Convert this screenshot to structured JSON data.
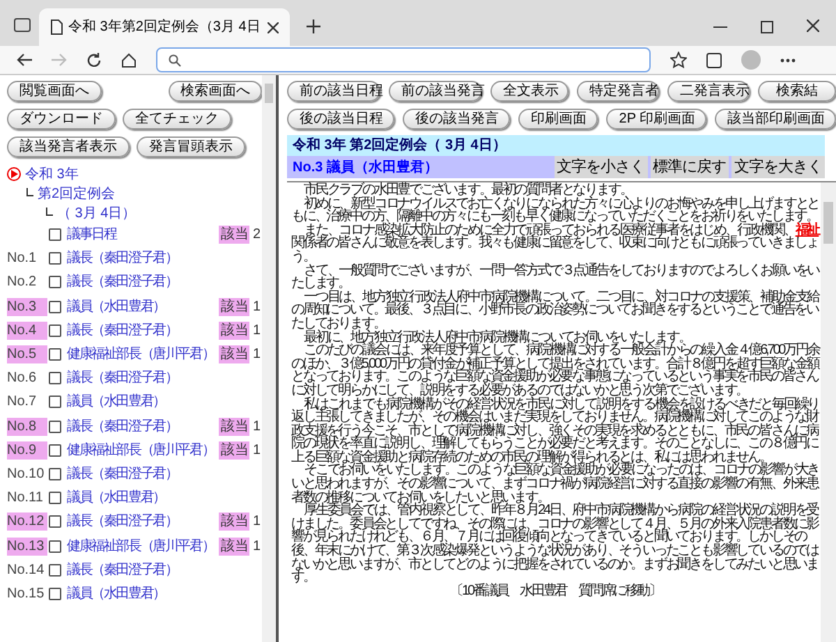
{
  "browser": {
    "tab_title": "令和 3年第2回定例会（3月 4日"
  },
  "left_buttons": [
    [
      "閲覧画面へ",
      "検索画面へ"
    ],
    [
      "ダウンロード",
      "全てチェック"
    ],
    [
      "該当発言者表示",
      "発言冒頭表示"
    ]
  ],
  "tree": {
    "label": "令和 3年",
    "children": [
      {
        "label": "第2回定例会",
        "children": [
          {
            "label": "（ 3月 4日）"
          }
        ]
      }
    ]
  },
  "speeches": [
    {
      "highlighted": false,
      "checked": false,
      "label": "議事日程",
      "badge": "該当",
      "count": "2"
    },
    {
      "no": "No.1",
      "highlighted": false,
      "checked": false,
      "label": "議長（秦田澄子君）"
    },
    {
      "no": "No.2",
      "highlighted": false,
      "checked": false,
      "label": "議長（秦田澄子君）"
    },
    {
      "no": "No.3",
      "highlighted": true,
      "checked": false,
      "label": "議員（水田豊君）",
      "badge": "該当",
      "count": "1"
    },
    {
      "no": "No.4",
      "highlighted": true,
      "checked": false,
      "label": "議長（秦田澄子君）",
      "badge": "該当",
      "count": "1"
    },
    {
      "no": "No.5",
      "highlighted": true,
      "checked": false,
      "label": "健康福祉部長（唐川平君）",
      "badge": "該当",
      "count": "1"
    },
    {
      "no": "No.6",
      "highlighted": false,
      "checked": false,
      "label": "議長（秦田澄子君）"
    },
    {
      "no": "No.7",
      "highlighted": false,
      "checked": false,
      "label": "議員（水田豊君）"
    },
    {
      "no": "No.8",
      "highlighted": true,
      "checked": false,
      "label": "議長（秦田澄子君）",
      "badge": "該当",
      "count": "1"
    },
    {
      "no": "No.9",
      "highlighted": true,
      "checked": false,
      "label": "健康福祉部長（唐川平君）",
      "badge": "該当",
      "count": "1"
    },
    {
      "no": "No.10",
      "highlighted": false,
      "checked": false,
      "label": "議長（秦田澄子君）"
    },
    {
      "no": "No.11",
      "highlighted": false,
      "checked": false,
      "label": "議員（水田豊君）"
    },
    {
      "no": "No.12",
      "highlighted": true,
      "checked": false,
      "label": "議長（秦田澄子君）",
      "badge": "該当",
      "count": "1"
    },
    {
      "no": "No.13",
      "highlighted": true,
      "checked": false,
      "label": "健康福祉部長（唐川平君）",
      "badge": "該当",
      "count": "1"
    },
    {
      "no": "No.14",
      "highlighted": false,
      "checked": false,
      "label": "議長（秦田澄子君）"
    },
    {
      "no": "No.15",
      "highlighted": false,
      "checked": false,
      "label": "議員（水田豊君）"
    }
  ],
  "toolbar": [
    [
      "前の該当日程",
      "前の該当発言",
      "全文表示",
      "特定発言者",
      "二発言表示",
      "検索結"
    ],
    [
      "後の該当日程",
      "後の該当発言",
      "印刷画面",
      "2P 印刷画面",
      "該当部印刷画面"
    ]
  ],
  "meeting_title": "令和 3年 第2回定例会（ 3月 4日）",
  "speaker": "No.3 議員（水田豊君）",
  "font_buttons": [
    "文字を小さく",
    "標準に戻す",
    "文字を大きく"
  ],
  "paragraphs": [
    {
      "kind": "body",
      "text": "市民クラブの水田豊でございます。最初の質問者となります。"
    },
    {
      "kind": "body",
      "text": "初めに、新型コロナウイルスでお亡くなりになられた方々に心よりのお悔やみを申し上げますとともに、治療中の方、隔離中の方々にも一刻も早く健康になっていただくことをお祈りをいたします。"
    },
    {
      "kind": "body",
      "text": "また、コロナ感染拡大防止のために全力で頑張っておられる医療従事者をはじめ、行政機関、**福祉**関係者の皆さんに敬意を表します。我々も健康に留意をして、収束に向けともに頑張っていきましょう。"
    },
    {
      "kind": "body",
      "text": "さて、一般質問でございますが、一問一答方式で３点通告をしておりますのでよろしくお願いをいたします。"
    },
    {
      "kind": "body",
      "text": "一つ目は、地方独立行政法人府中市病院機構について。二つ目に、対コロナの支援策、補助金支給の周知について。最後、３点目に、小野市長の政治姿勢についてお聞きをするということで通告をいたしております。"
    },
    {
      "kind": "body",
      "text": "最初に、地方独立行政法人府中市病院機構についてお伺いをいたします。"
    },
    {
      "kind": "body",
      "text": "このたびの議会には、来年度予算として、病院機構に対する一般会計からの繰入金４億6,700万円余のほか、３億5,000万円の貸付金が補正予算として提出をされています。合計８億円を超す巨額な金額となっております。このような巨額な資金援助が必要な事態になっているという事実を市民の皆さんに対して明らかにして、説明をする必要があるのではないかと思う次第でございます。"
    },
    {
      "kind": "body",
      "text": "私はこれまでも病院機構がその経営状況を市民に対して説明をする機会を設けるべきだと毎回繰り返し主張してきましたが、その機会はいまだ実現をしておりません。病院機構に対してこのような財政支援を行う今こそ、市として病院機構に対し、強くその実現を求めるとともに、市民の皆さんに病院の現状を率直に説明し、理解してもらうことが必要だと考えます。そのことなしに、この８億円に上る巨額な資金援助と病院存続のための市民の理解が得られるとは、私には思われません。"
    },
    {
      "kind": "body",
      "text": "そこでお伺いをいたします。このような巨額な資金援助が必要になったのは、コロナの影響が大きいと思われますが、その影響について、まずコロナ禍が病院経営に対する直接の影響の有無、外来患者数の推移についてお伺いをしたいと思います。"
    },
    {
      "kind": "body",
      "text": "厚生委員会では、管内視察として、昨年８月24日、府中市病院機構から病院の経営状況の説明を受けました。委員会としてですね、その際には、コロナの影響として４月、５月の外来入院患者数に影響が見られたけれども、６月、７月には回復傾向となってきていると聞いております。しかしその後、年末にかけて、第３次感染爆発というような状況があり、そういったことも影響しているのではないかと思いますが、市としてどのように把握をされているのか。まずお聞きをしてみたいと思います。"
    },
    {
      "kind": "note",
      "text": "〔10番議員　水田豊君　質問席に移動〕"
    }
  ]
}
